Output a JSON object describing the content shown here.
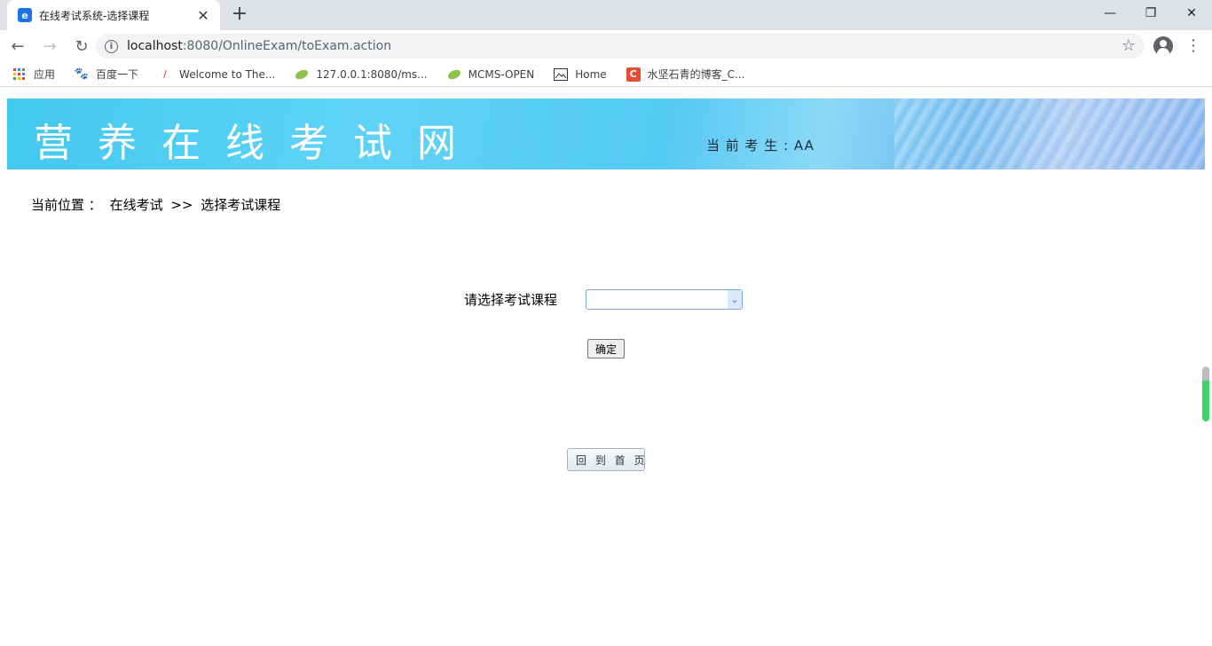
{
  "browser": {
    "tab_title": "在线考试系统-选择课程",
    "tab_favicon": "e",
    "url_host": "localhost",
    "url_rest": ":8080/OnlineExam/toExam.action",
    "bookmarks": [
      {
        "label": "应用",
        "icon": "apps-grid-icon"
      },
      {
        "label": "百度一下",
        "icon": "baidu-paw-icon"
      },
      {
        "label": "Welcome to The...",
        "icon": "feather-icon"
      },
      {
        "label": "127.0.0.1:8080/ms...",
        "icon": "spring-leaf-icon"
      },
      {
        "label": "MCMS-OPEN",
        "icon": "spring-leaf-icon"
      },
      {
        "label": "Home",
        "icon": "image-icon"
      },
      {
        "label": "水坚石青的博客_C...",
        "icon": "csdn-c-icon"
      }
    ]
  },
  "banner": {
    "site_title": "营养在线考试网",
    "current_user_label": "当 前 考 生 : ",
    "current_user_name": "AA"
  },
  "breadcrumb": {
    "prefix": "当前位置 ：",
    "section": "在线考试",
    "separator": ">>",
    "current": "选择考试课程"
  },
  "form": {
    "course_label": "请选择考试课程",
    "course_selected": "",
    "confirm_label": "确定"
  },
  "home_button_label": "回 到 首 页",
  "colors": {
    "banner_accent": "#42c8f0",
    "select_border": "#7aa7e0",
    "widget_green": "#3ed46b"
  }
}
